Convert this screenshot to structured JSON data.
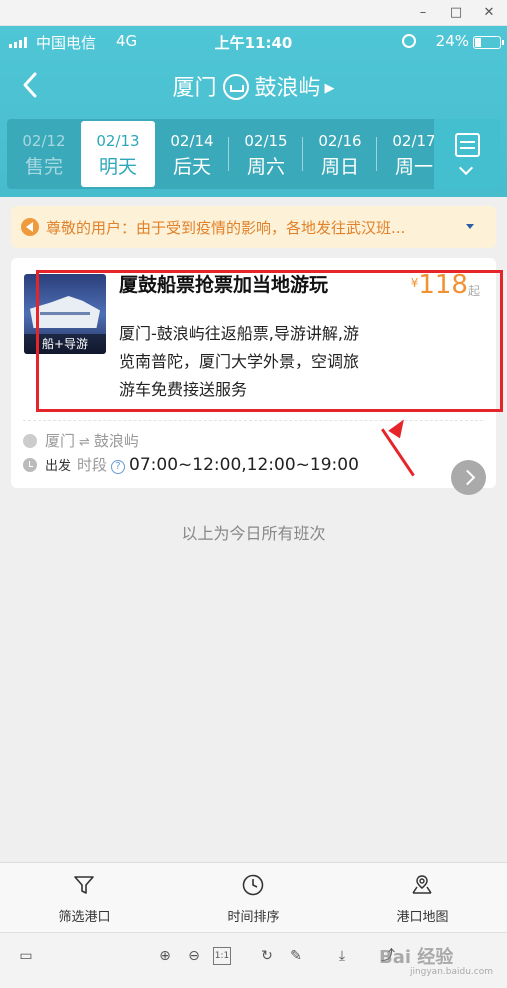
{
  "window": {
    "minimize": "–",
    "maximize": "□",
    "close": "✕"
  },
  "status": {
    "carrier": "中国电信",
    "network": "4G",
    "time": "上午11:40",
    "battery": "24%",
    "battery_level": 0.24
  },
  "nav": {
    "from": "厦门",
    "to": "鼓浪屿",
    "dropdown": "▶"
  },
  "dates": [
    {
      "date": "02/12",
      "label": "售完",
      "state": "sold"
    },
    {
      "date": "02/13",
      "label": "明天",
      "state": "active"
    },
    {
      "date": "02/14",
      "label": "后天",
      "state": "normal"
    },
    {
      "date": "02/15",
      "label": "周六",
      "state": "normal"
    },
    {
      "date": "02/16",
      "label": "周日",
      "state": "normal"
    },
    {
      "date": "02/17",
      "label": "周一",
      "state": "normal"
    }
  ],
  "notice": {
    "text": "尊敬的用户：由于受到疫情的影响，各地发往武汉班..."
  },
  "product": {
    "tag": "船+导游",
    "title": "厦鼓船票抢票加当地游玩",
    "desc": "厦门-鼓浪屿往返船票,导游讲解,游览南普陀，厦门大学外景，空调旅游车免费接送服务",
    "currency": "¥",
    "price": "118",
    "price_suffix": "起",
    "from": "厦门",
    "to": "鼓浪屿",
    "depart_label": "出发",
    "period_label": "时段",
    "hours": "07:00~12:00,12:00~19:00"
  },
  "end_note": "以上为今日所有班次",
  "tabs": [
    {
      "label": "筛选港口",
      "icon": "filter-icon"
    },
    {
      "label": "时间排序",
      "icon": "clock-icon"
    },
    {
      "label": "港口地图",
      "icon": "map-icon"
    }
  ],
  "viewer": {
    "zoom_reset": "1:1"
  },
  "watermark": {
    "main": "Bai 经验",
    "sub": "jingyan.baidu.com"
  },
  "colors": {
    "header": "#4fc6d6",
    "accent": "#2da8bb",
    "price": "#f09232",
    "notice_text": "#e1822a",
    "highlight": "#e5252a"
  }
}
